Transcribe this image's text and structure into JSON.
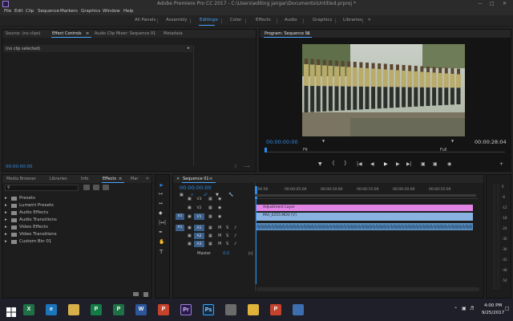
{
  "window": {
    "title": "Adobe Premiere Pro CC 2017 - C:\\Users\\editing jangar\\Documents\\Untitled.prproj *"
  },
  "menu": [
    "File",
    "Edit",
    "Clip",
    "Sequence",
    "Markers",
    "Graphics",
    "Window",
    "Help"
  ],
  "workspaces": [
    "All Panels",
    "Assembly",
    "Editing",
    "Color",
    "Effects",
    "Audio",
    "Graphics",
    "Libraries"
  ],
  "workspace_active": "Editing",
  "source_panel": {
    "tabs": [
      "Source: (no clips)",
      "Effect Controls",
      "Audio Clip Mixer: Sequence 01",
      "Metadata"
    ],
    "active_tab": "Effect Controls",
    "no_clip": "(no clip selected)",
    "timecode": "00:00:00:00"
  },
  "program": {
    "title": "Program: Sequence 01",
    "timecode": "00:00:00:00",
    "fit": "Fit",
    "quality": "Full",
    "duration": "00:00:28:04"
  },
  "effects_panel": {
    "tabs": [
      "Media Browser",
      "Libraries",
      "Info",
      "Effects",
      "Mar"
    ],
    "active_tab": "Effects",
    "items": [
      "Presets",
      "Lumetri Presets",
      "Audio Effects",
      "Audio Transitions",
      "Video Effects",
      "Video Transitions",
      "Custom Bin 01"
    ]
  },
  "timeline": {
    "title": "Sequence 01",
    "timecode": "00:00:00:00",
    "ruler": [
      ":00:00",
      "00:00:05:00",
      "00:00:10:00",
      "00:00:15:00",
      "00:00:20:00",
      "00:00:25:00"
    ],
    "video_tracks": [
      "V3",
      "V2",
      "V1"
    ],
    "audio_tracks": [
      "A1",
      "A2",
      "A3"
    ],
    "source_v": "V1",
    "source_a": "A1",
    "master_label": "Master",
    "master_value": "0.0",
    "clips": {
      "adjustment": "Adjustment Layer",
      "video": "MVI_0255.MOV [V]"
    },
    "meter_labels": [
      "0",
      "-6",
      "-12",
      "-18",
      "-24",
      "-30",
      "-36",
      "-42",
      "-48",
      "-54"
    ]
  },
  "taskbar": {
    "time": "4:00 PM",
    "date": "9/25/2017",
    "apps": [
      {
        "label": "X",
        "color": "#1e7145",
        "name": "excel"
      },
      {
        "label": "e",
        "color": "#1b75bb",
        "name": "ie"
      },
      {
        "label": "",
        "color": "#d8b04a",
        "name": "explorer"
      },
      {
        "label": "P",
        "color": "#137b46",
        "name": "publisher"
      },
      {
        "label": "P",
        "color": "#1e7145",
        "name": "project"
      },
      {
        "label": "W",
        "color": "#2b579a",
        "name": "word"
      },
      {
        "label": "P",
        "color": "#c4432b",
        "name": "powerpoint"
      },
      {
        "label": "Pr",
        "color": "#2a1a4a",
        "name": "premiere"
      },
      {
        "label": "Ps",
        "color": "#0f2a44",
        "name": "photoshop"
      },
      {
        "label": "",
        "color": "#6b6b6b",
        "name": "app-gray"
      },
      {
        "label": "",
        "color": "#e0b43a",
        "name": "chrome"
      },
      {
        "label": "P",
        "color": "#c4432b",
        "name": "powerpoint2"
      },
      {
        "label": "",
        "color": "#3d6fb0",
        "name": "app-blue"
      }
    ]
  }
}
